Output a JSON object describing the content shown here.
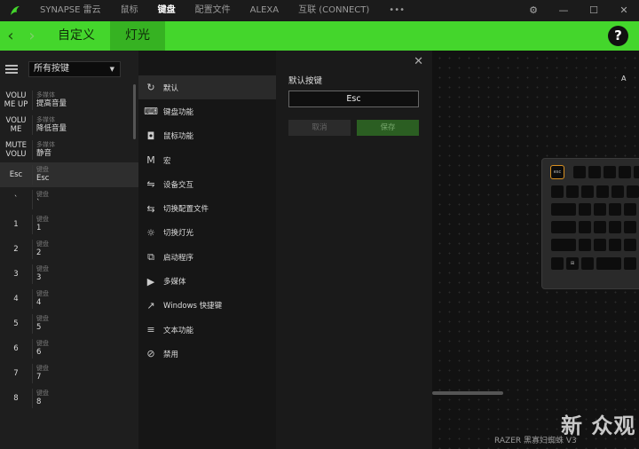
{
  "titlebar": {
    "tabs": [
      {
        "label": "SYNAPSE 雷云"
      },
      {
        "label": "鼠标"
      },
      {
        "label": "键盘",
        "active": true
      },
      {
        "label": "配置文件"
      },
      {
        "label": "ALEXA"
      },
      {
        "label": "互联 (CONNECT)"
      },
      {
        "label": "•••"
      }
    ]
  },
  "header": {
    "subtabs": [
      {
        "label": "自定义",
        "active": false
      },
      {
        "label": "灯光",
        "active": true
      }
    ],
    "help_label": "?"
  },
  "filter": {
    "selected": "所有按键"
  },
  "keys": [
    {
      "name": "VOLU\nME UP",
      "category": "多媒体",
      "value": "提高音量"
    },
    {
      "name": "VOLU\nME",
      "category": "多媒体",
      "value": "降低音量"
    },
    {
      "name": "MUTE\nVOLU",
      "category": "多媒体",
      "value": "静音"
    },
    {
      "name": "Esc",
      "category": "键盘",
      "value": "Esc",
      "selected": true
    },
    {
      "name": "`",
      "category": "键盘",
      "value": "`"
    },
    {
      "name": "1",
      "category": "键盘",
      "value": "1"
    },
    {
      "name": "2",
      "category": "键盘",
      "value": "2"
    },
    {
      "name": "3",
      "category": "键盘",
      "value": "3"
    },
    {
      "name": "4",
      "category": "键盘",
      "value": "4"
    },
    {
      "name": "5",
      "category": "键盘",
      "value": "5"
    },
    {
      "name": "6",
      "category": "键盘",
      "value": "6"
    },
    {
      "name": "7",
      "category": "键盘",
      "value": "7"
    },
    {
      "name": "8",
      "category": "键盘",
      "value": "8"
    }
  ],
  "functions": [
    {
      "label": "默认",
      "icon": "reset-icon",
      "selected": true
    },
    {
      "label": "键盘功能",
      "icon": "keyboard-icon"
    },
    {
      "label": "鼠标功能",
      "icon": "mouse-icon"
    },
    {
      "label": "宏",
      "icon": "macro-icon"
    },
    {
      "label": "设备交互",
      "icon": "device-interaction-icon"
    },
    {
      "label": "切换配置文件",
      "icon": "switch-profile-icon"
    },
    {
      "label": "切换灯光",
      "icon": "switch-lighting-icon"
    },
    {
      "label": "启动程序",
      "icon": "launch-program-icon"
    },
    {
      "label": "多媒体",
      "icon": "multimedia-icon"
    },
    {
      "label": "Windows 快捷键",
      "icon": "windows-shortcut-icon"
    },
    {
      "label": "文本功能",
      "icon": "text-function-icon"
    },
    {
      "label": "禁用",
      "icon": "disable-icon"
    }
  ],
  "detail": {
    "label": "默认按键",
    "key_value": "Esc",
    "cancel_label": "取消",
    "save_label": "保存"
  },
  "preview": {
    "device_name": "RAZER 黑寡妇蜘蛛 V3",
    "watermark": "新 众观"
  },
  "colors": {
    "accent": "#44d62c",
    "highlight": "#d89021"
  }
}
